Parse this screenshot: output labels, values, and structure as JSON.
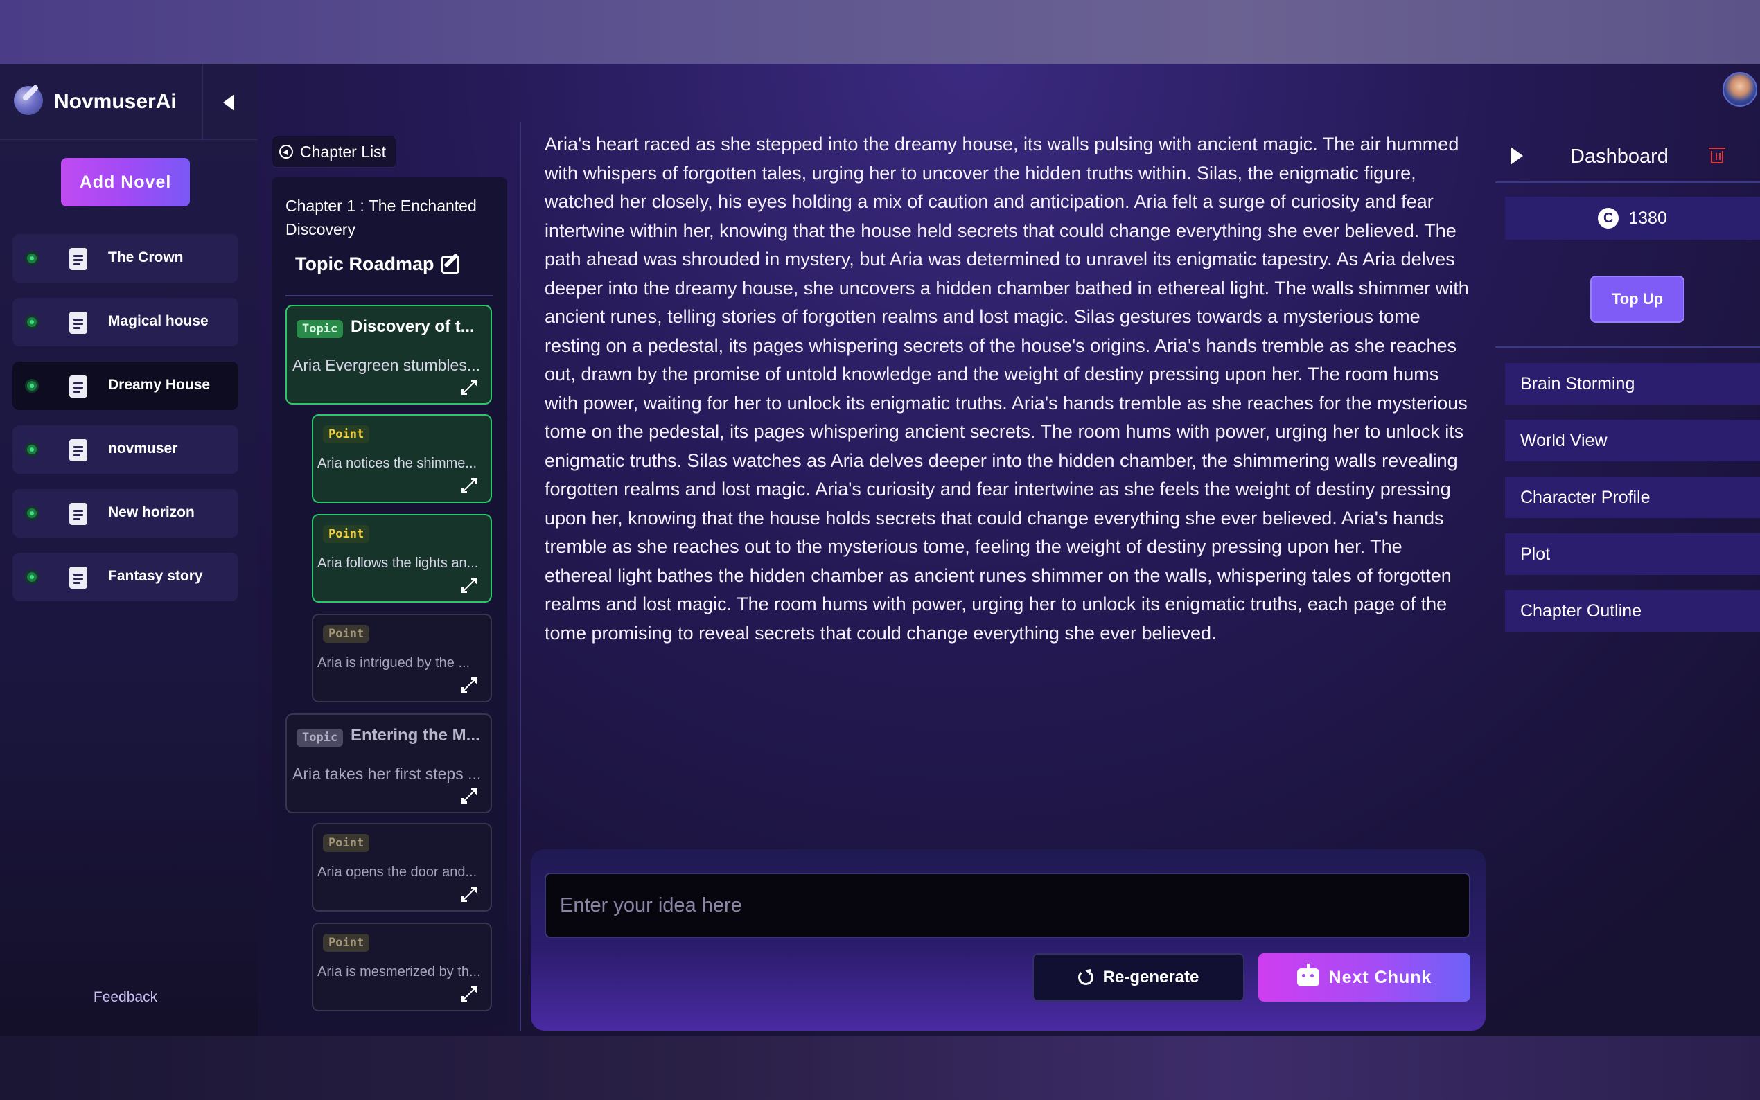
{
  "app": {
    "name": "NovmuserAi"
  },
  "sidebar": {
    "add_novel_label": "Add Novel",
    "novels": [
      {
        "title": "The Crown",
        "active": false
      },
      {
        "title": "Magical house",
        "active": false
      },
      {
        "title": "Dreamy House",
        "active": true
      },
      {
        "title": "novmuser",
        "active": false
      },
      {
        "title": "New horizon",
        "active": false
      },
      {
        "title": "Fantasy story",
        "active": false
      }
    ],
    "feedback_label": "Feedback"
  },
  "chapter": {
    "list_button_label": "Chapter List",
    "title": "Chapter 1 : The Enchanted Discovery",
    "roadmap_label": "Topic Roadmap",
    "items": [
      {
        "kind": "topic",
        "badge": "Topic",
        "heading": "Discovery of t...",
        "body": "Aria Evergreen stumbles...",
        "highlighted": true
      },
      {
        "kind": "point",
        "badge": "Point",
        "body": "Aria notices the shimme...",
        "highlighted": true
      },
      {
        "kind": "point",
        "badge": "Point",
        "body": "Aria follows the lights an...",
        "highlighted": true
      },
      {
        "kind": "point",
        "badge": "Point",
        "body": "Aria is intrigued by the ...",
        "highlighted": false
      },
      {
        "kind": "topic",
        "badge": "Topic",
        "heading": "Entering the M...",
        "body": "Aria takes her first steps ...",
        "highlighted": false
      },
      {
        "kind": "point",
        "badge": "Point",
        "body": "Aria opens the door and...",
        "highlighted": false
      },
      {
        "kind": "point",
        "badge": "Point",
        "body": "Aria is mesmerized by th...",
        "highlighted": false
      }
    ]
  },
  "main": {
    "story_text": "Aria's heart raced as she stepped into the dreamy house, its walls pulsing with ancient magic. The air hummed with whispers of forgotten tales, urging her to uncover the hidden truths within. Silas, the enigmatic figure, watched her closely, his eyes holding a mix of caution and anticipation. Aria felt a surge of curiosity and fear intertwine within her, knowing that the house held secrets that could change everything she ever believed. The path ahead was shrouded in mystery, but Aria was determined to unravel its enigmatic tapestry.  As Aria delves deeper into the dreamy house, she uncovers a hidden chamber bathed in ethereal light. The walls shimmer with ancient runes, telling stories of forgotten realms and lost magic. Silas gestures towards a mysterious tome resting on a pedestal, its pages whispering secrets of the house's origins. Aria's hands tremble as she reaches out, drawn by the promise of untold knowledge and the weight of destiny pressing upon her. The room hums with power, waiting for her to unlock its enigmatic truths. Aria's hands tremble as she reaches for the mysterious tome on the pedestal, its pages whispering ancient secrets. The room hums with power, urging her to unlock its enigmatic truths. Silas watches as Aria delves deeper into the hidden chamber, the shimmering walls revealing forgotten realms and lost magic. Aria's curiosity and fear intertwine as she feels the weight of destiny pressing upon her, knowing that the house holds secrets that could change everything she ever believed.  Aria's hands tremble as she reaches out to the mysterious tome, feeling the weight of destiny pressing upon her. The ethereal light bathes the hidden chamber as ancient runes shimmer on the walls, whispering tales of forgotten realms and lost magic. The room hums with power, urging her to unlock its enigmatic truths, each page of the tome promising to reveal secrets that could change everything she ever believed.",
    "idea_placeholder": "Enter your idea here",
    "regenerate_label": "Re-generate",
    "next_chunk_label": "Next Chunk"
  },
  "dashboard": {
    "title": "Dashboard",
    "coin_symbol": "C",
    "credits": "1380",
    "top_up_label": "Top Up",
    "menu": [
      "Brain Storming",
      "World View",
      "Character Profile",
      "Plot",
      "Chapter Outline"
    ]
  }
}
